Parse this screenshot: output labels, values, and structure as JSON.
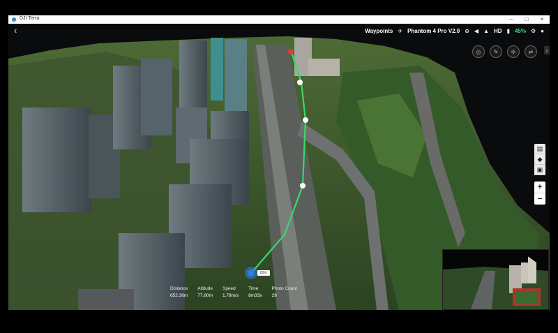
{
  "window": {
    "title": "DJI Terra",
    "controls": [
      "–",
      "□",
      "×"
    ]
  },
  "topbar": {
    "mode": "Waypoints",
    "aircraft": "Phantom 4 Pro V2.0",
    "video_quality": "HD",
    "battery": "45%",
    "accent_color": "#3fd67a"
  },
  "route": {
    "color": "#3ad86a",
    "tag": "82m"
  },
  "stats": [
    {
      "label": "Distance",
      "value": "652.36m"
    },
    {
      "label": "Altitude",
      "value": "77.80m"
    },
    {
      "label": "Speed",
      "value": "1.78m/s"
    },
    {
      "label": "Time",
      "value": "8m33s"
    },
    {
      "label": "Photo Count",
      "value": "29"
    }
  ]
}
